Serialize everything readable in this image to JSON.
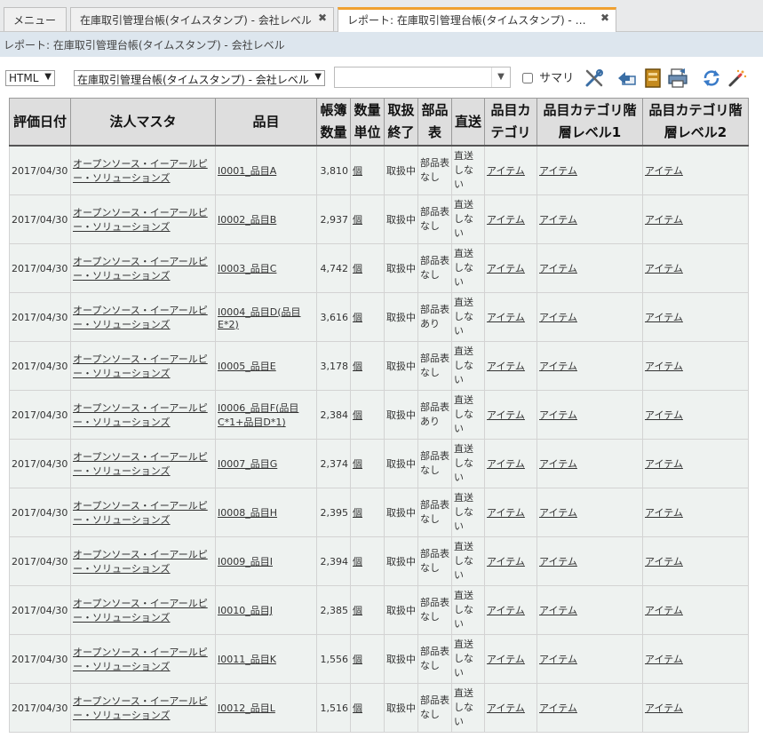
{
  "tabs": [
    {
      "label": "メニュー"
    },
    {
      "label": "在庫取引管理台帳(タイムスタンプ) - 会社レベル"
    },
    {
      "label": "レポート: 在庫取引管理台帳(タイムスタンプ) - 会..."
    }
  ],
  "breadcrumb": "レポート: 在庫取引管理台帳(タイムスタンプ) - 会社レベル",
  "toolbar": {
    "format_select": "HTML",
    "report_select": "在庫取引管理台帳(タイムスタンプ) - 会社レベル",
    "combo_value": "",
    "summary_label": "サマリ",
    "icons": [
      "tools-icon",
      "upload-arrow-icon",
      "export-sheet-icon",
      "print-icon",
      "refresh-icon",
      "magic-wand-icon"
    ]
  },
  "table": {
    "headers": [
      "評価日付",
      "法人マスタ",
      "品目",
      "帳簿数量",
      "数量単位",
      "取扱終了",
      "部品表",
      "直送",
      "品目カテゴリ",
      "品目カテゴリ階層レベル1",
      "品目カテゴリ階層レベル2"
    ],
    "rows": [
      [
        "2017/04/30",
        "オープンソース・イーアールピー・ソリューションズ",
        "I0001_品目A",
        "3,810",
        "個",
        "取扱中",
        "部品表なし",
        "直送しない",
        "アイテム",
        "アイテム",
        "アイテム"
      ],
      [
        "2017/04/30",
        "オープンソース・イーアールピー・ソリューションズ",
        "I0002_品目B",
        "2,937",
        "個",
        "取扱中",
        "部品表なし",
        "直送しない",
        "アイテム",
        "アイテム",
        "アイテム"
      ],
      [
        "2017/04/30",
        "オープンソース・イーアールピー・ソリューションズ",
        "I0003_品目C",
        "4,742",
        "個",
        "取扱中",
        "部品表なし",
        "直送しない",
        "アイテム",
        "アイテム",
        "アイテム"
      ],
      [
        "2017/04/30",
        "オープンソース・イーアールピー・ソリューションズ",
        "I0004_品目D(品目E*2)",
        "3,616",
        "個",
        "取扱中",
        "部品表あり",
        "直送しない",
        "アイテム",
        "アイテム",
        "アイテム"
      ],
      [
        "2017/04/30",
        "オープンソース・イーアールピー・ソリューションズ",
        "I0005_品目E",
        "3,178",
        "個",
        "取扱中",
        "部品表なし",
        "直送しない",
        "アイテム",
        "アイテム",
        "アイテム"
      ],
      [
        "2017/04/30",
        "オープンソース・イーアールピー・ソリューションズ",
        "I0006_品目F(品目C*1+品目D*1)",
        "2,384",
        "個",
        "取扱中",
        "部品表あり",
        "直送しない",
        "アイテム",
        "アイテム",
        "アイテム"
      ],
      [
        "2017/04/30",
        "オープンソース・イーアールピー・ソリューションズ",
        "I0007_品目G",
        "2,374",
        "個",
        "取扱中",
        "部品表なし",
        "直送しない",
        "アイテム",
        "アイテム",
        "アイテム"
      ],
      [
        "2017/04/30",
        "オープンソース・イーアールピー・ソリューションズ",
        "I0008_品目H",
        "2,395",
        "個",
        "取扱中",
        "部品表なし",
        "直送しない",
        "アイテム",
        "アイテム",
        "アイテム"
      ],
      [
        "2017/04/30",
        "オープンソース・イーアールピー・ソリューションズ",
        "I0009_品目I",
        "2,394",
        "個",
        "取扱中",
        "部品表なし",
        "直送しない",
        "アイテム",
        "アイテム",
        "アイテム"
      ],
      [
        "2017/04/30",
        "オープンソース・イーアールピー・ソリューションズ",
        "I0010_品目J",
        "2,385",
        "個",
        "取扱中",
        "部品表なし",
        "直送しない",
        "アイテム",
        "アイテム",
        "アイテム"
      ],
      [
        "2017/04/30",
        "オープンソース・イーアールピー・ソリューションズ",
        "I0011_品目K",
        "1,556",
        "個",
        "取扱中",
        "部品表なし",
        "直送しない",
        "アイテム",
        "アイテム",
        "アイテム"
      ],
      [
        "2017/04/30",
        "オープンソース・イーアールピー・ソリューションズ",
        "I0012_品目L",
        "1,516",
        "個",
        "取扱中",
        "部品表なし",
        "直送しない",
        "アイテム",
        "アイテム",
        "アイテム"
      ]
    ]
  }
}
